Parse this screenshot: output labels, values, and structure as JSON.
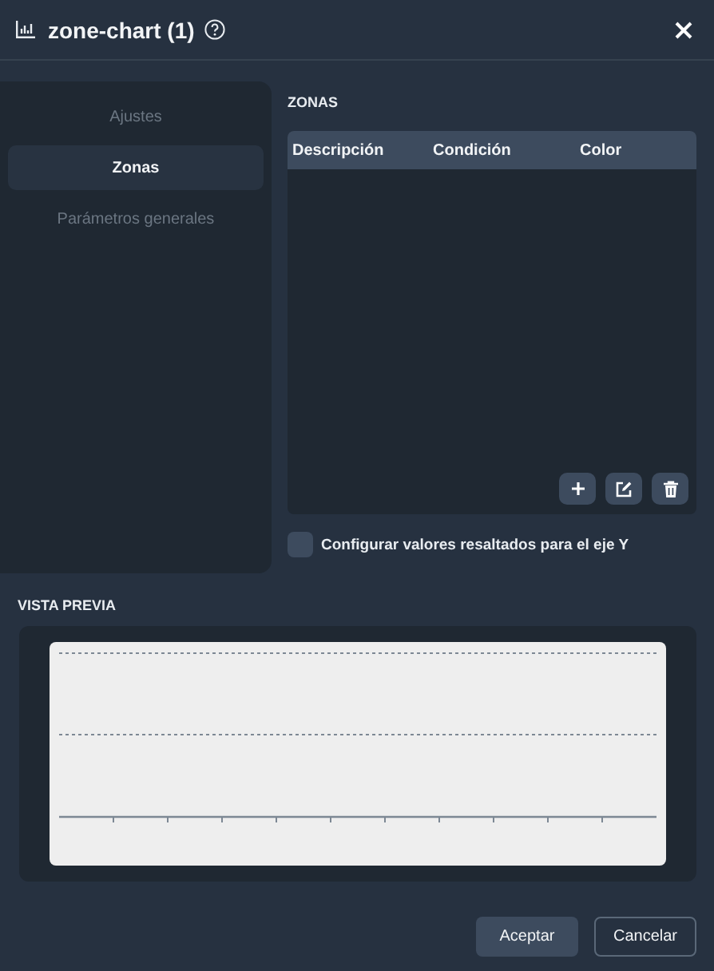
{
  "window": {
    "title": "zone-chart (1)"
  },
  "sidebar": {
    "items": [
      {
        "label": "Ajustes",
        "selected": false
      },
      {
        "label": "Zonas",
        "selected": true
      },
      {
        "label": "Parámetros generales",
        "selected": false
      }
    ]
  },
  "zones": {
    "title": "ZONAS",
    "columns": [
      "Descripción",
      "Condición",
      "Color"
    ]
  },
  "highlight_option": {
    "label": "Configurar valores resaltados para el eje Y",
    "checked": false
  },
  "preview": {
    "title": "VISTA PREVIA"
  },
  "buttons": [
    {
      "label": "Aceptar",
      "kind": "primary"
    },
    {
      "label": "Cancelar",
      "kind": "secondary"
    }
  ]
}
